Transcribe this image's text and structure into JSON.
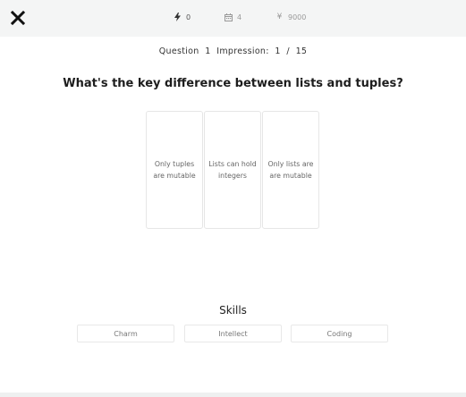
{
  "topbar": {
    "close_icon": "close-icon",
    "stats": {
      "energy": {
        "icon": "bolt-icon",
        "value": "0"
      },
      "days": {
        "icon": "calendar-icon",
        "value": "4"
      },
      "money": {
        "icon": "yen-icon",
        "symbol": "¥",
        "value": "9000"
      }
    }
  },
  "progress": {
    "question_label": "Question",
    "question_number": "1",
    "impression_label": "Impression:",
    "impression_current": "1",
    "separator": "/",
    "impression_total": "15"
  },
  "question": {
    "text": "What's the key difference between lists and tuples?"
  },
  "answers": [
    {
      "label": "Only tuples are mutable"
    },
    {
      "label": "Lists can hold integers"
    },
    {
      "label": "Only lists are are mutable"
    }
  ],
  "skills": {
    "title": "Skills",
    "items": [
      {
        "label": "Charm"
      },
      {
        "label": "Intellect"
      },
      {
        "label": "Coding"
      }
    ]
  },
  "colors": {
    "topbar_bg": "#f4f5f5",
    "card_border": "#e6e6e6",
    "text_muted": "#9a9a9a"
  }
}
